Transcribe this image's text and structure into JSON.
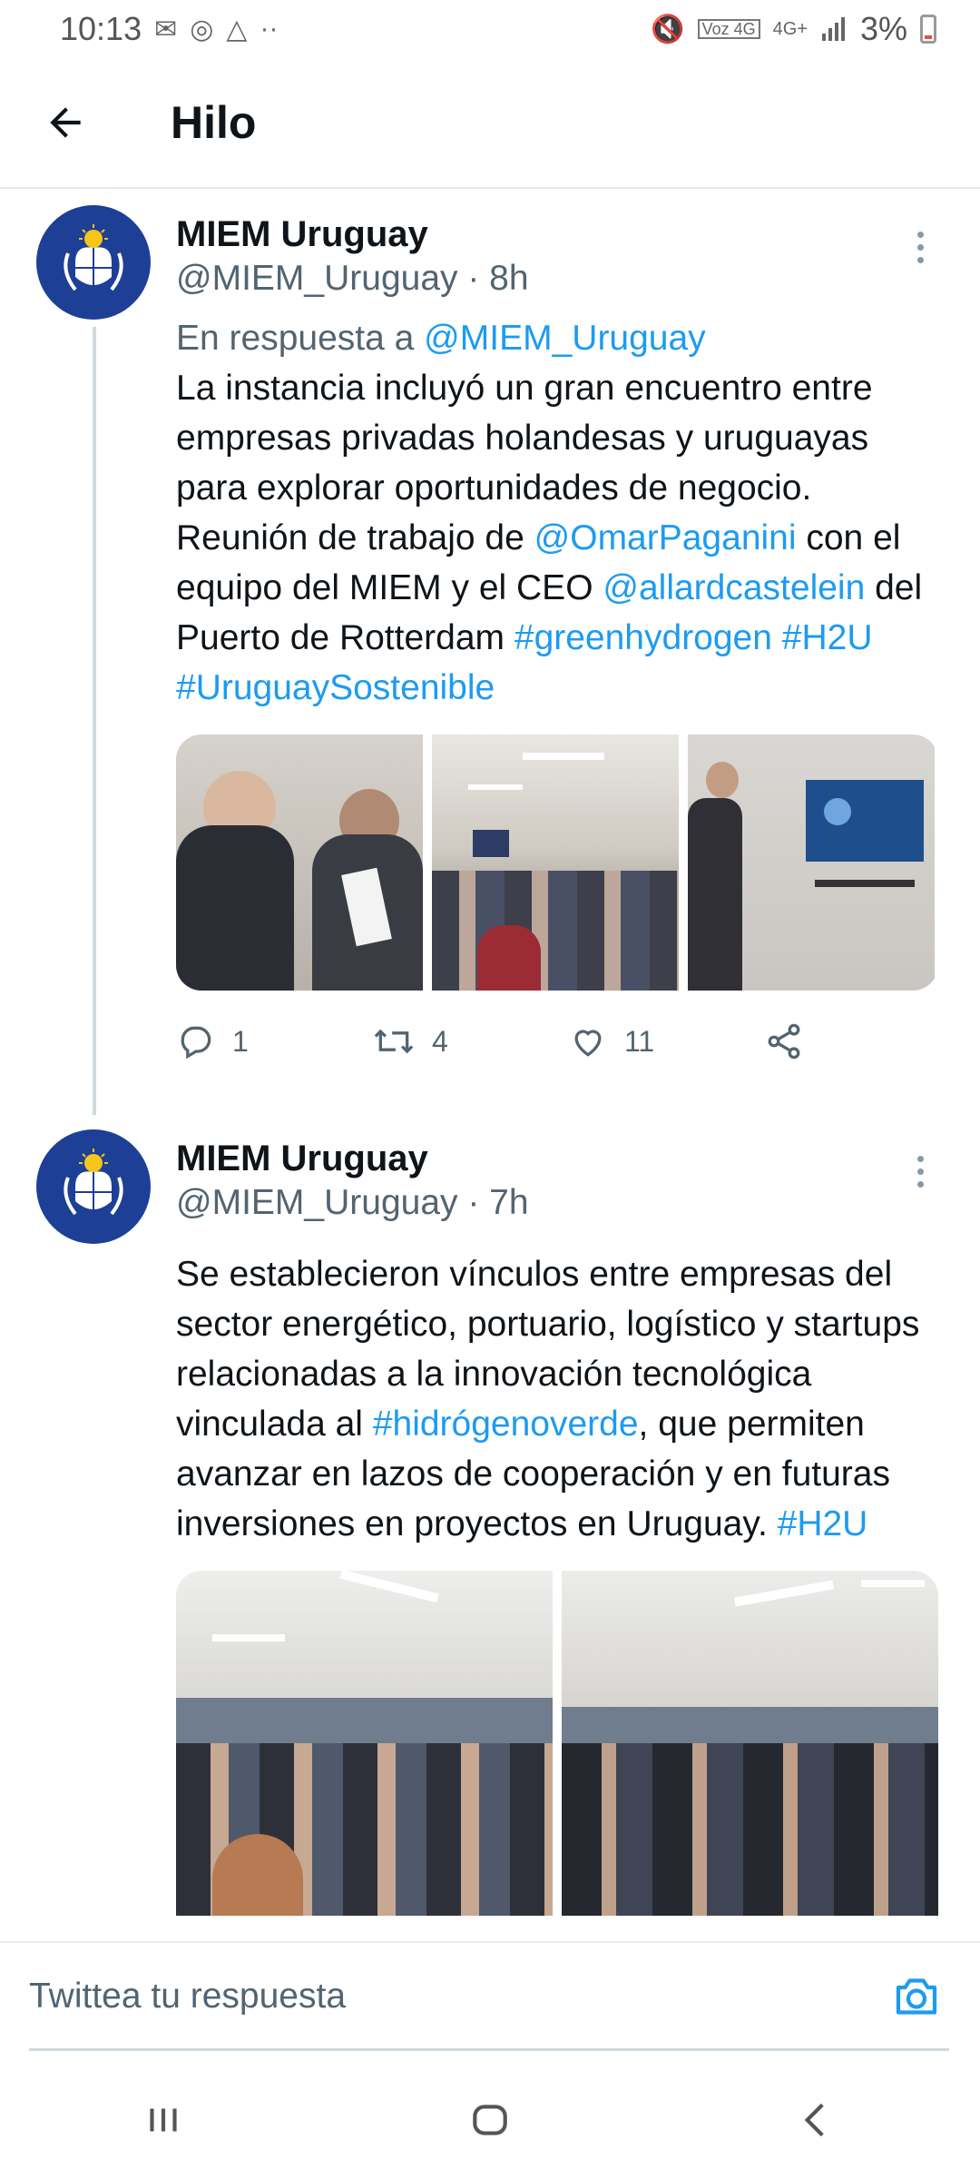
{
  "status_bar": {
    "time": "10:13",
    "battery_percent": "3%",
    "network": "4G+",
    "volte": "Voz 4G"
  },
  "app_bar": {
    "title": "Hilo"
  },
  "tweets": [
    {
      "name": "MIEM Uruguay",
      "handle": "@MIEM_Uruguay",
      "time": "· 8h",
      "reply_prefix": "En respuesta a ",
      "reply_handle": "@MIEM_Uruguay",
      "text": {
        "p1": "La instancia incluyó un gran encuentro entre empresas privadas holandesas y uruguayas para explorar oportunidades de negocio. Reunión de trabajo de ",
        "mention1": "@OmarPaganini",
        "p2": " con el equipo del MIEM y el CEO ",
        "mention2": "@allardcastelein",
        "p3": " del Puerto de Rotterdam ",
        "tag1": "#greenhydrogen",
        "tag2": "#H2U",
        "tag3": "#UruguaySostenible"
      },
      "stats": {
        "replies": "1",
        "retweets": "4",
        "likes": "11"
      }
    },
    {
      "name": "MIEM Uruguay",
      "handle": "@MIEM_Uruguay",
      "time": "· 7h",
      "text": {
        "p1": "Se establecieron vínculos entre empresas del sector energético, portuario, logístico y startups relacionadas a la innovación tecnológica vinculada al ",
        "tag1": "#hidrógenoverde",
        "p2": ", que permiten avanzar en lazos de cooperación y en futuras inversiones en proyectos en Uruguay. ",
        "tag2": "#H2U"
      }
    }
  ],
  "reply_bar": {
    "placeholder": "Twittea tu respuesta"
  },
  "colors": {
    "link": "#1d9bf0",
    "secondary_text": "#536471",
    "avatar_bg": "#1d3f96",
    "divider": "#e6ecf0"
  },
  "icons": [
    "back-arrow-icon",
    "more-vert-icon",
    "reply-icon",
    "retweet-icon",
    "like-icon",
    "share-icon",
    "camera-icon",
    "recents-icon",
    "home-icon",
    "back-nav-icon"
  ]
}
